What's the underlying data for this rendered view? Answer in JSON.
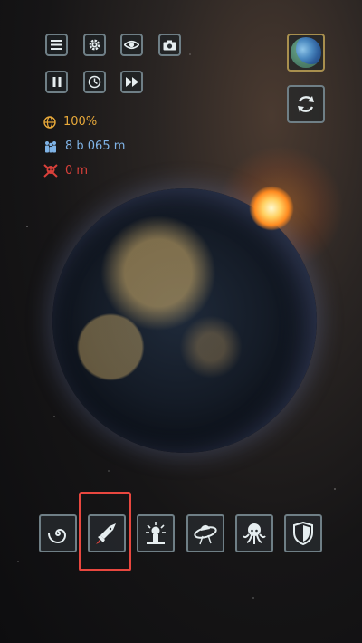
{
  "stats": {
    "integrity": "100%",
    "population": "8 b 065 m",
    "deaths": "0 m"
  },
  "colors": {
    "integrity": "#e8a93a",
    "population": "#7fb3e6",
    "deaths": "#d9403a",
    "highlight": "#e8473f",
    "button_border": "#6f7f86"
  },
  "icons": {
    "menu": "menu-icon",
    "settings": "gear-icon",
    "view": "eye-icon",
    "screenshot": "camera-icon",
    "pause": "pause-icon",
    "time": "clock-icon",
    "fast_forward": "fast-forward-icon",
    "planet_select": "earth-thumbnail-icon",
    "rotate": "refresh-icon"
  },
  "toolbar": [
    {
      "name": "black-hole-tool",
      "icon": "spiral-icon"
    },
    {
      "name": "missile-tool",
      "icon": "missile-icon",
      "selected": true
    },
    {
      "name": "explosion-tool",
      "icon": "blast-icon"
    },
    {
      "name": "ufo-tool",
      "icon": "ufo-icon"
    },
    {
      "name": "monster-tool",
      "icon": "octopus-icon"
    },
    {
      "name": "shield-tool",
      "icon": "shield-icon"
    }
  ]
}
